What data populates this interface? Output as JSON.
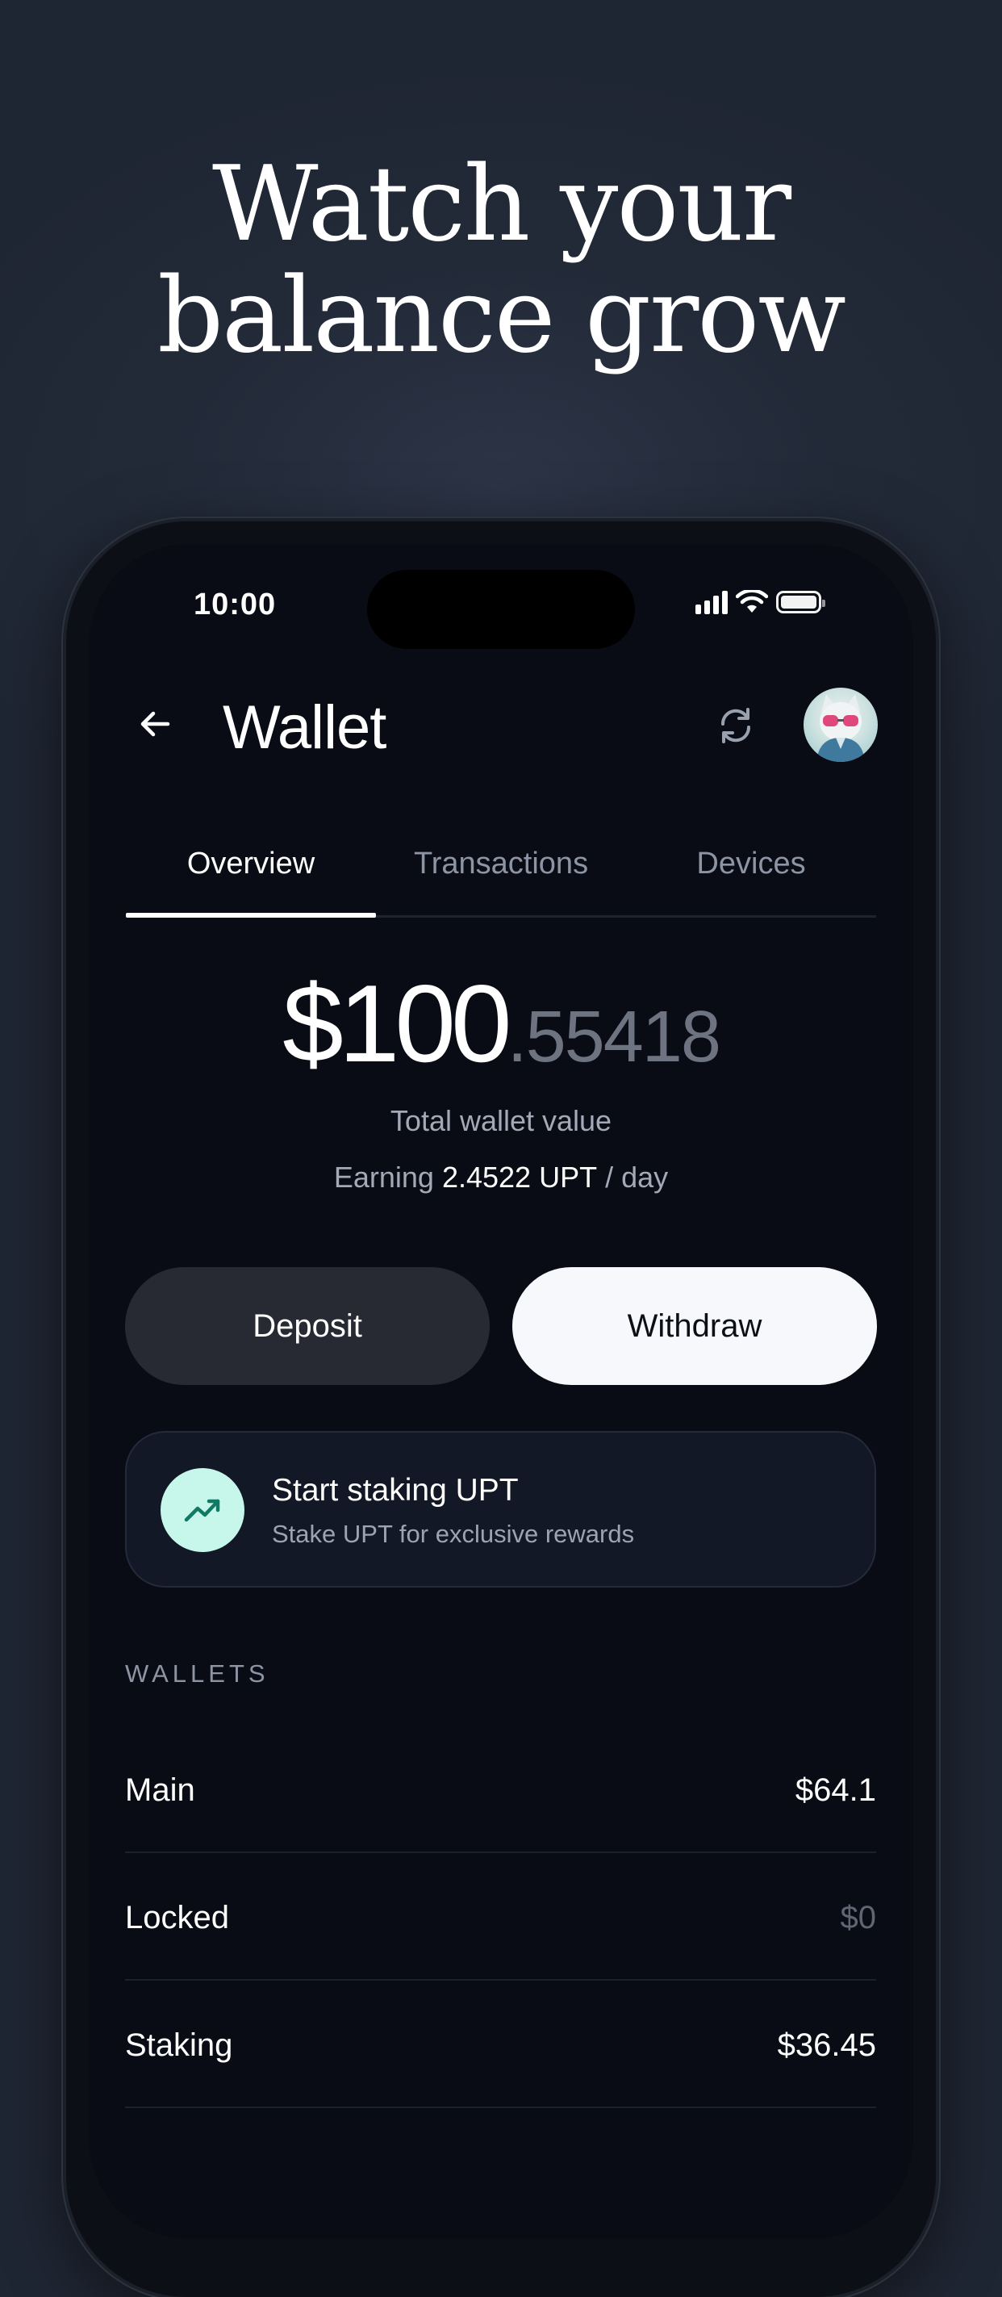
{
  "headline": {
    "line1": "Watch your",
    "line2": "balance grow"
  },
  "status_bar": {
    "time": "10:00"
  },
  "header": {
    "title": "Wallet"
  },
  "tabs": [
    {
      "label": "Overview",
      "active": true
    },
    {
      "label": "Transactions",
      "active": false
    },
    {
      "label": "Devices",
      "active": false
    }
  ],
  "balance": {
    "whole": "$100",
    "fraction": ".55418",
    "caption": "Total wallet value",
    "earning_prefix": "Earning",
    "earning_amount": "2.4522 UPT",
    "earning_suffix": "/ day"
  },
  "actions": {
    "deposit_label": "Deposit",
    "withdraw_label": "Withdraw"
  },
  "staking_card": {
    "title": "Start staking UPT",
    "subtitle": "Stake UPT for exclusive rewards",
    "icon": "trending-up-icon",
    "icon_bg": "#c7f7ea"
  },
  "wallets": {
    "section_label": "WALLETS",
    "rows": [
      {
        "name": "Main",
        "value": "$64.1"
      },
      {
        "name": "Locked",
        "value": "$0"
      },
      {
        "name": "Staking",
        "value": "$36.45"
      }
    ]
  },
  "colors": {
    "background": "#222a38",
    "screen": "#090c14",
    "accent_mint": "#c7f7ea",
    "withdraw_bg": "#f6f8fb",
    "deposit_bg": "#272a33"
  }
}
